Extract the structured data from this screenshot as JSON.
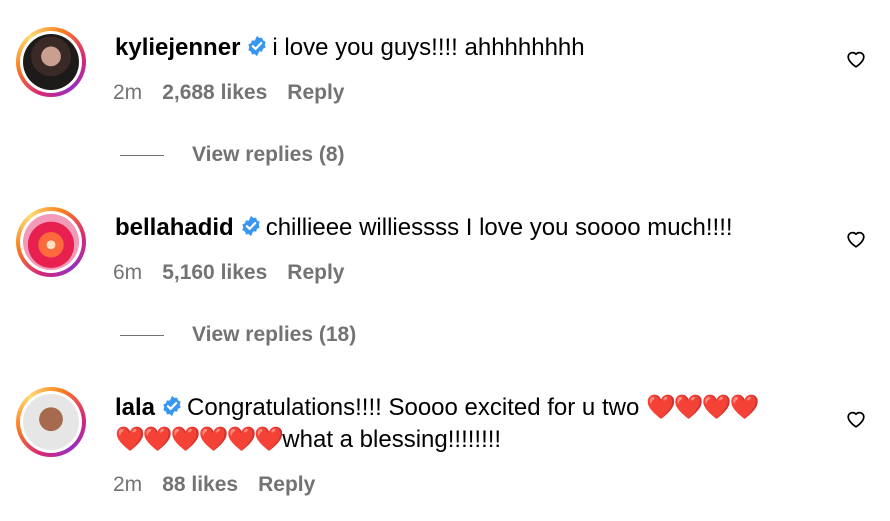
{
  "comments": [
    {
      "username": "kyliejenner",
      "text": "i love you guys!!!! ahhhhhhhh",
      "time": "2m",
      "likes": "2,688 likes",
      "reply_label": "Reply",
      "view_replies": "View replies (8)"
    },
    {
      "username": "bellahadid",
      "text": "chillieee williessss I love you soooo much!!!!",
      "time": "6m",
      "likes": "5,160 likes",
      "reply_label": "Reply",
      "view_replies": "View replies (18)"
    },
    {
      "username": "lala",
      "text_line1": "Congratulations!!!! Soooo excited for u two",
      "hearts_line1": "❤️❤️❤️❤️",
      "hearts_line2": "❤️❤️❤️❤️❤️❤️",
      "text_line2": "what a blessing!!!!!!!!",
      "time": "2m",
      "likes": "88 likes",
      "reply_label": "Reply"
    }
  ],
  "icons": {
    "verified": "verified-badge-icon",
    "like": "heart-outline-icon"
  },
  "colors": {
    "verified": "#3897f0",
    "meta": "#737373",
    "heart": "#e0245e"
  }
}
